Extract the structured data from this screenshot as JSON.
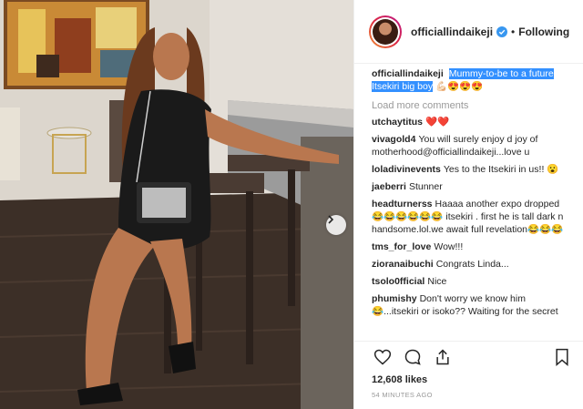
{
  "header": {
    "username": "officiallindaikeji",
    "separator": "•",
    "follow_status": "Following"
  },
  "caption": {
    "username": "officiallindaikeji",
    "highlighted_text": "Mummy-to-be to a future Itsekiri big boy",
    "emojis": "💪🏻😍😍😍"
  },
  "load_more": "Load more comments",
  "comments": [
    {
      "user": "utchaytitus",
      "text": "❤️❤️"
    },
    {
      "user": "vivagold4",
      "text": "You will surely enjoy d joy of motherhood@officiallindaikeji...love u"
    },
    {
      "user": "loladivinevents",
      "text": "Yes to the Itsekiri in us!! 😮"
    },
    {
      "user": "jaeberri",
      "text": "Stunner"
    },
    {
      "user": "headturnerss",
      "text": "Haaaa another expo dropped 😂😂😂😂😂😂 itsekiri . first he is tall dark n handsome.lol.we await full revelation😂😂😂"
    },
    {
      "user": "tms_for_love",
      "text": "Wow!!!"
    },
    {
      "user": "zioranaibuchi",
      "text": "Congrats Linda..."
    },
    {
      "user": "tsolo0fficial",
      "text": "Nice"
    },
    {
      "user": "phumishy",
      "text": "Don't worry we know him 😂...itsekiri or isoko?? Waiting for the secret"
    }
  ],
  "footer": {
    "likes": "12,608 likes",
    "time": "54 MINUTES AGO"
  },
  "icons": {
    "like": "heart-icon",
    "comment": "comment-icon",
    "share": "share-icon",
    "save": "bookmark-icon",
    "verified": "verified-badge-icon",
    "next": "chevron-right-icon"
  },
  "colors": {
    "highlight": "#3390ff",
    "verified": "#3897f0",
    "muted": "#999999",
    "text": "#262626"
  }
}
